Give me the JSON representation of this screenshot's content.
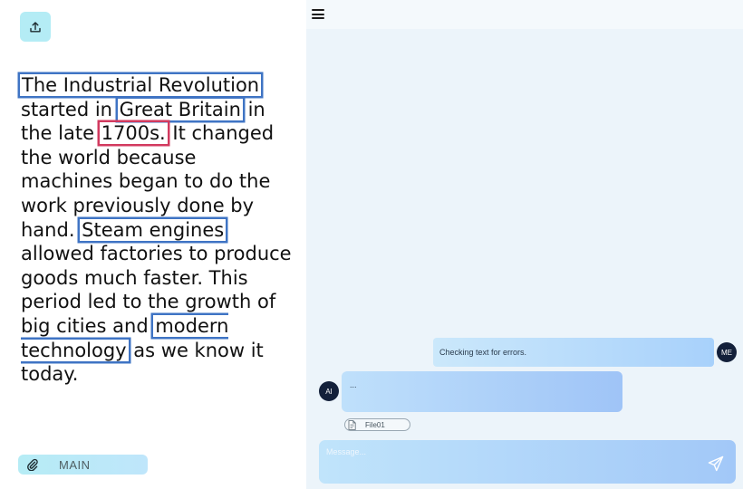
{
  "left": {
    "text_segments": [
      {
        "text": "The Industrial Revolution",
        "highlight": "blue"
      },
      {
        "text": " started in ",
        "highlight": "none"
      },
      {
        "text": "Great Britain",
        "highlight": "blue"
      },
      {
        "text": " in the late ",
        "highlight": "none"
      },
      {
        "text": "1700s.",
        "highlight": "red"
      },
      {
        "text": " It changed the world because machines began to do the work previously done by hand. ",
        "highlight": "none"
      },
      {
        "text": "Steam engines",
        "highlight": "blue"
      },
      {
        "text": " allowed factories to produce goods much faster. This period led to the growth of big cities and ",
        "highlight": "none"
      },
      {
        "text": "modern technology",
        "highlight": "blue"
      },
      {
        "text": " as we know it today.",
        "highlight": "none"
      }
    ],
    "main_label": "MAIN"
  },
  "chat": {
    "messages": [
      {
        "sender": "ME",
        "text": "Checking text for errors."
      },
      {
        "sender": "AI",
        "text": "..."
      }
    ],
    "attachment": {
      "name": "File01"
    },
    "composer": {
      "placeholder": "Message..."
    }
  },
  "icons": {
    "upload": "upload-icon",
    "menu": "hamburger-menu-icon",
    "attach": "paperclip-icon",
    "file": "document-icon",
    "send": "send-icon"
  },
  "colors": {
    "highlight_blue": "#3f74c4",
    "highlight_red": "#d23a5f",
    "avatar_bg": "#13203a",
    "panel_bg": "#ecf4fa",
    "button_bg": "#b4ecf5"
  }
}
